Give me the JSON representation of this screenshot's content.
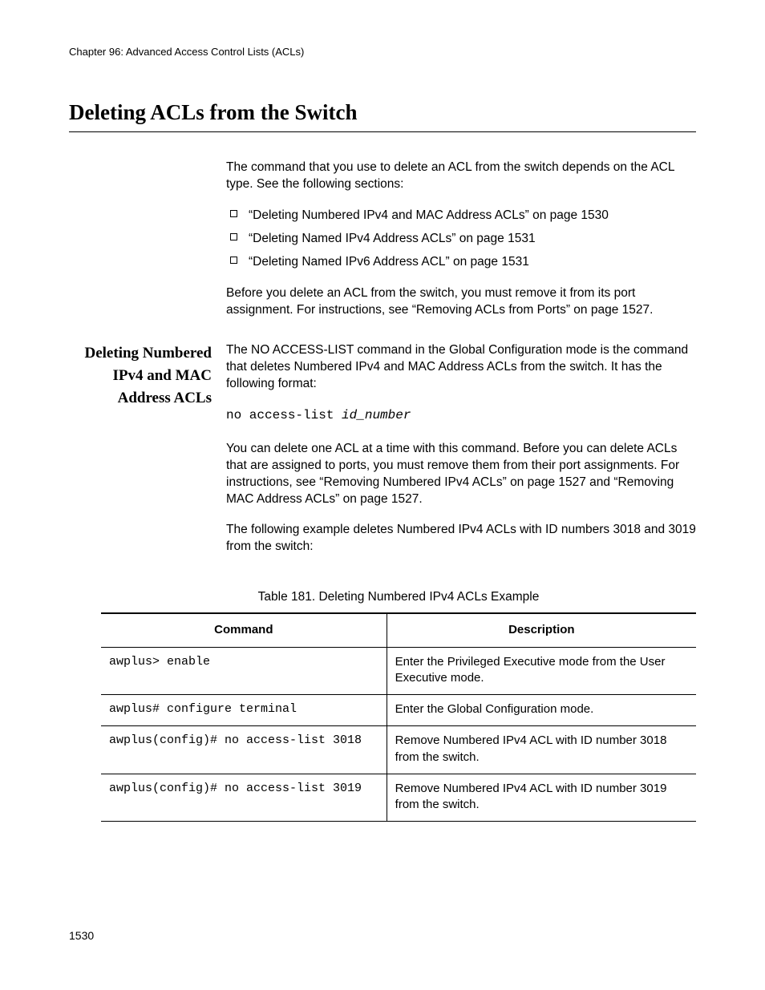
{
  "header": {
    "running": "Chapter 96: Advanced Access Control Lists (ACLs)",
    "title": "Deleting ACLs from the Switch"
  },
  "intro": {
    "p1": "The command that you use to delete an ACL from the switch depends on the ACL type. See the following sections:",
    "bullets": [
      "“Deleting Numbered IPv4 and MAC Address ACLs” on page 1530",
      "“Deleting Named IPv4 Address ACLs” on page 1531",
      "“Deleting Named IPv6 Address ACL” on page 1531"
    ],
    "p2": "Before you delete an ACL from the switch, you must remove it from its port assignment. For instructions, see “Removing ACLs from Ports” on page 1527."
  },
  "section1": {
    "heading": "Deleting Numbered IPv4 and MAC Address ACLs",
    "p1": "The NO ACCESS-LIST command in the Global Configuration mode is the command that deletes Numbered IPv4 and MAC Address ACLs from the switch. It has the following format:",
    "code_cmd": "no access-list ",
    "code_arg": "id_number",
    "p2": "You can delete one ACL at a time with this command. Before you can delete ACLs that are assigned to ports, you must remove them from their port assignments. For instructions, see “Removing Numbered IPv4 ACLs” on page 1527 and “Removing MAC Address ACLs” on page 1527.",
    "p3": "The following example deletes Numbered IPv4 ACLs with ID numbers 3018 and 3019 from the switch:"
  },
  "table": {
    "caption": "Table 181. Deleting Numbered IPv4 ACLs Example",
    "headers": {
      "cmd": "Command",
      "desc": "Description"
    },
    "rows": [
      {
        "cmd": "awplus> enable",
        "desc": "Enter the Privileged Executive mode from the User Executive mode."
      },
      {
        "cmd": "awplus# configure terminal",
        "desc": "Enter the Global Configuration mode."
      },
      {
        "cmd": "awplus(config)# no access-list 3018",
        "desc": "Remove Numbered IPv4 ACL with ID number 3018 from the switch."
      },
      {
        "cmd": "awplus(config)# no access-list 3019",
        "desc": "Remove Numbered IPv4 ACL with ID number 3019 from the switch."
      }
    ]
  },
  "footer": {
    "page": "1530"
  }
}
